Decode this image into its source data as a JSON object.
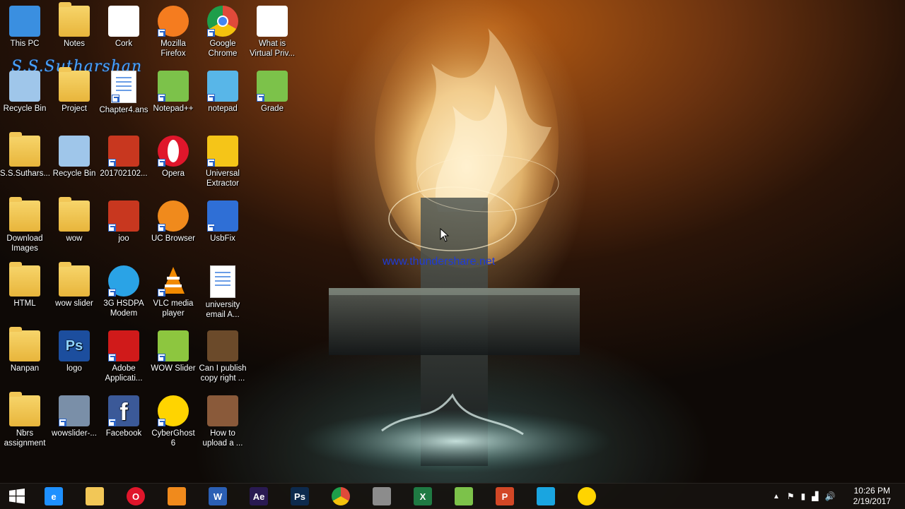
{
  "desktop": {
    "signature": "S.S.Sutharshan",
    "watermark_url": "www.thundershare.net",
    "icons": [
      {
        "label": "This PC",
        "glyph": "pc-icon",
        "color": "#3a8fe0"
      },
      {
        "label": "Notes",
        "glyph": "folder-icon",
        "color": "#f2c757"
      },
      {
        "label": "Cork",
        "glyph": "document-thumbnail-icon",
        "color": "#ffffff"
      },
      {
        "label": "Mozilla Firefox",
        "glyph": "firefox-icon",
        "color": "#f57c1f"
      },
      {
        "label": "Google Chrome",
        "glyph": "chrome-icon",
        "color": "#e04a3a"
      },
      {
        "label": "What is Virtual Priv...",
        "glyph": "video-thumbnail-icon",
        "color": "#ffffff"
      },
      {
        "label": "Recycle Bin",
        "glyph": "recycle-bin-icon",
        "color": "#9fc6ea"
      },
      {
        "label": "Project",
        "glyph": "folder-chrome-icon",
        "color": "#f2c757"
      },
      {
        "label": "Chapter4.ans",
        "glyph": "word-doc-icon",
        "color": "#ffffff"
      },
      {
        "label": "Notepad++",
        "glyph": "notepadpp-icon",
        "color": "#7cc24a"
      },
      {
        "label": "notepad",
        "glyph": "notepad-icon",
        "color": "#58b6e8"
      },
      {
        "label": "Grade",
        "glyph": "grade-icon",
        "color": "#7cc24a"
      },
      {
        "label": "S.S.Suthars...",
        "glyph": "user-folder-icon",
        "color": "#f2c757"
      },
      {
        "label": "Recycle Bin",
        "glyph": "recycle-bin-full-icon",
        "color": "#9fc6ea"
      },
      {
        "label": "201702102...",
        "glyph": "pdf-icon",
        "color": "#c8371f"
      },
      {
        "label": "Opera",
        "glyph": "opera-icon",
        "color": "#e0162b"
      },
      {
        "label": "Universal Extractor",
        "glyph": "extractor-icon",
        "color": "#f5c518"
      },
      {
        "label": "Download Images",
        "glyph": "folder-icon",
        "color": "#f2c757"
      },
      {
        "label": "wow",
        "glyph": "folder-icon",
        "color": "#f2c757"
      },
      {
        "label": "joo",
        "glyph": "pdf-icon",
        "color": "#c8371f"
      },
      {
        "label": "UC Browser",
        "glyph": "uc-browser-icon",
        "color": "#f08a1c"
      },
      {
        "label": "UsbFix",
        "glyph": "usbfix-icon",
        "color": "#2f6fd6"
      },
      {
        "label": "HTML",
        "glyph": "folder-icon",
        "color": "#f2c757"
      },
      {
        "label": "wow slider",
        "glyph": "folder-icon",
        "color": "#f2c757"
      },
      {
        "label": "3G HSDPA Modem",
        "glyph": "globe-icon",
        "color": "#2aa3e6"
      },
      {
        "label": "VLC media player",
        "glyph": "vlc-icon",
        "color": "#f18a00"
      },
      {
        "label": "university email A...",
        "glyph": "text-file-icon",
        "color": "#ffffff"
      },
      {
        "label": "Nanpan",
        "glyph": "folder-icon",
        "color": "#f2c757"
      },
      {
        "label": "logo",
        "glyph": "photoshop-file-icon",
        "color": "#1c4e9e"
      },
      {
        "label": "Adobe Applicati...",
        "glyph": "adobe-icon",
        "color": "#d01a1a"
      },
      {
        "label": "WOW Slider",
        "glyph": "wowslider-icon",
        "color": "#8dc63f"
      },
      {
        "label": "Can I publish copy right ...",
        "glyph": "video-thumbnail-icon",
        "color": "#6b4a2a"
      },
      {
        "label": "Nbrs assignment",
        "glyph": "folder-icon",
        "color": "#f2c757"
      },
      {
        "label": "wowslider-...",
        "glyph": "installer-icon",
        "color": "#7a8fa8"
      },
      {
        "label": "Facebook",
        "glyph": "facebook-icon",
        "color": "#3b5998"
      },
      {
        "label": "CyberGhost 6",
        "glyph": "cyberghost-icon",
        "color": "#ffd400"
      },
      {
        "label": "How to upload a ...",
        "glyph": "video-thumbnail-icon",
        "color": "#8a5a3a"
      }
    ]
  },
  "taskbar": {
    "start": {
      "glyph": "windows-start-icon"
    },
    "items": [
      {
        "glyph": "internet-explorer-icon",
        "text": "e",
        "color": "#1e90ff"
      },
      {
        "glyph": "file-explorer-icon",
        "text": "",
        "color": "#f2c757"
      },
      {
        "glyph": "opera-icon",
        "text": "O",
        "color": "#e0162b"
      },
      {
        "glyph": "uc-browser-icon",
        "text": "",
        "color": "#f08a1c"
      },
      {
        "glyph": "word-icon",
        "text": "W",
        "color": "#2b5fb4"
      },
      {
        "glyph": "after-effects-icon",
        "text": "Ae",
        "color": "#2a1a52"
      },
      {
        "glyph": "photoshop-icon",
        "text": "Ps",
        "color": "#0d2a4d"
      },
      {
        "glyph": "chrome-icon",
        "text": "",
        "color": "#e04a3a"
      },
      {
        "glyph": "app-grid-icon",
        "text": "",
        "color": "#8c8c8c"
      },
      {
        "glyph": "excel-icon",
        "text": "X",
        "color": "#1f7a43"
      },
      {
        "glyph": "notepadpp-icon",
        "text": "",
        "color": "#7cc24a"
      },
      {
        "glyph": "powerpoint-icon",
        "text": "P",
        "color": "#d24726"
      },
      {
        "glyph": "screen-recorder-icon",
        "text": "",
        "color": "#1aa5e0"
      },
      {
        "glyph": "cyberghost-icon",
        "text": "",
        "color": "#ffd400"
      }
    ],
    "clock": {
      "time": "10:26 PM",
      "date": "2/19/2017"
    }
  }
}
